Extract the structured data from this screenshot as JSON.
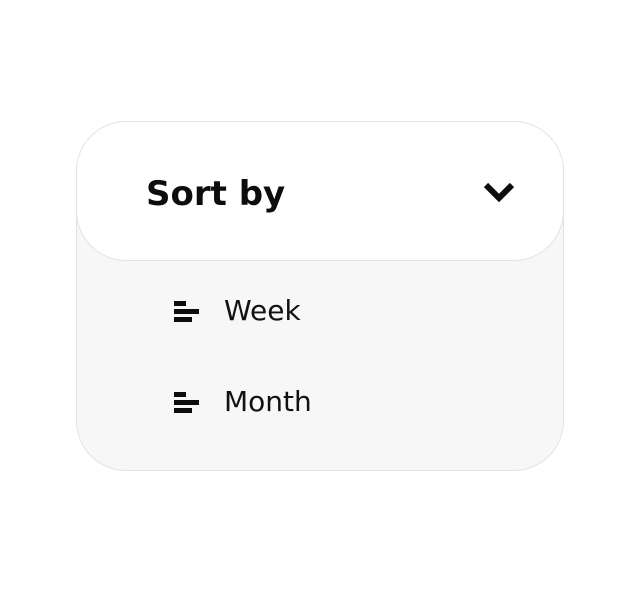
{
  "dropdown": {
    "title": "Sort by",
    "toggle_icon": "chevron-down-icon",
    "options": [
      {
        "label": "Week",
        "icon": "bar-align-left-icon"
      },
      {
        "label": "Month",
        "icon": "bar-align-left-icon"
      }
    ]
  },
  "colors": {
    "header_bg": "#ffffff",
    "menu_bg": "#f7f7f7",
    "border": "#e3e3e3",
    "text": "#0d0d0d"
  }
}
